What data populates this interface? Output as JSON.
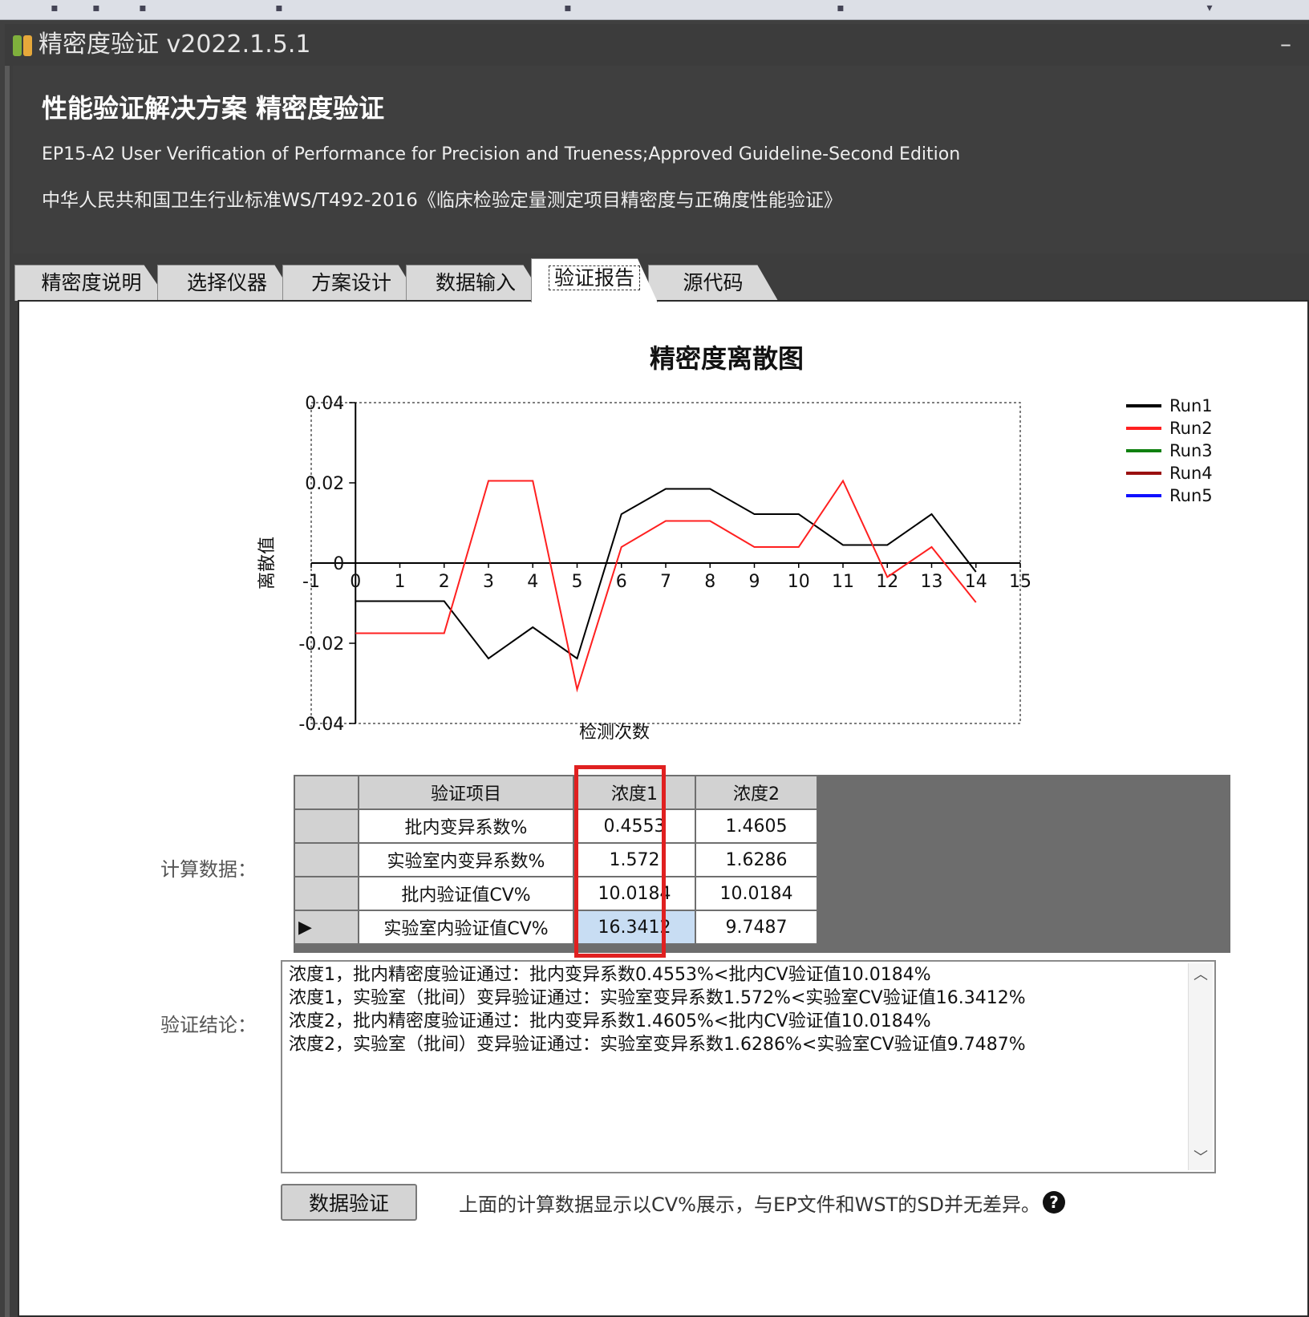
{
  "window": {
    "title": "精密度验证 v2022.1.5.1",
    "minimize_glyph": "–"
  },
  "header": {
    "title": "性能验证解决方案 精密度验证",
    "line1": "EP15-A2 User Verification of Performance for Precision and Trueness;Approved Guideline-Second Edition",
    "line2": "中华人民共和国卫生行业标准WS/T492-2016《临床检验定量测定项目精密度与正确度性能验证》"
  },
  "tabs": [
    {
      "label": "精密度说明"
    },
    {
      "label": "选择仪器"
    },
    {
      "label": "方案设计"
    },
    {
      "label": "数据输入"
    },
    {
      "label": "验证报告",
      "active": true
    },
    {
      "label": "源代码"
    }
  ],
  "chart_data": {
    "type": "line",
    "title": "精密度离散图",
    "xlabel": "检测次数",
    "ylabel": "离散值",
    "xlim": [
      -1,
      15
    ],
    "ylim": [
      -0.04,
      0.04
    ],
    "x_ticks": [
      "-1",
      "0",
      "1",
      "2",
      "3",
      "4",
      "5",
      "6",
      "7",
      "8",
      "9",
      "10",
      "11",
      "12",
      "13",
      "14",
      "15"
    ],
    "y_ticks": [
      "0.04",
      "0.02",
      "0",
      "-0.02",
      "-0.04"
    ],
    "legend_position": "right",
    "series": [
      {
        "name": "Run1",
        "color": "#000000",
        "x": [
          0,
          1,
          2,
          3,
          4,
          5,
          6,
          7,
          8,
          9,
          10,
          11,
          12,
          13,
          14
        ],
        "y": [
          -0.0095,
          -0.0095,
          -0.0095,
          -0.0238,
          -0.016,
          -0.0238,
          0.0122,
          0.0185,
          0.0185,
          0.0122,
          0.0122,
          0.0045,
          0.0045,
          0.0122,
          -0.0022
        ]
      },
      {
        "name": "Run2",
        "color": "#ff2020",
        "x": [
          0,
          1,
          2,
          3,
          4,
          5,
          6,
          7,
          8,
          9,
          10,
          11,
          12,
          13,
          14
        ],
        "y": [
          -0.0175,
          -0.0175,
          -0.0175,
          0.0205,
          0.0205,
          -0.0315,
          0.004,
          0.0105,
          0.0105,
          0.004,
          0.004,
          0.0205,
          -0.0035,
          0.004,
          -0.0098
        ]
      },
      {
        "name": "Run3",
        "color": "#108010",
        "x": [],
        "y": []
      },
      {
        "name": "Run4",
        "color": "#9a1010",
        "x": [],
        "y": []
      },
      {
        "name": "Run5",
        "color": "#1010ff",
        "x": [],
        "y": []
      }
    ]
  },
  "calc": {
    "label": "计算数据：",
    "columns": [
      "验证项目",
      "浓度1",
      "浓度2"
    ],
    "rows": [
      [
        "批内变异系数%",
        "0.4553",
        "1.4605"
      ],
      [
        "实验室内变异系数%",
        "1.572",
        "1.6286"
      ],
      [
        "批内验证值CV%",
        "10.0184",
        "10.0184"
      ],
      [
        "实验室内验证值CV%",
        "16.3412",
        "9.7487"
      ]
    ],
    "current_row_marker": "▶"
  },
  "conclusion": {
    "label": "验证结论：",
    "text": "浓度1，批内精密度验证通过：批内变异系数0.4553%<批内CV验证值10.0184%\n浓度1，实验室（批间）变异验证通过：实验室变异系数1.572%<实验室CV验证值16.3412%\n浓度2，批内精密度验证通过：批内变异系数1.4605%<批内CV验证值10.0184%\n浓度2，实验室（批间）变异验证通过：实验室变异系数1.6286%<实验室CV验证值9.7487%"
  },
  "footer": {
    "button_label": "数据验证",
    "note": "上面的计算数据显示以CV%展示，与EP文件和WST的SD并无差异。",
    "help_glyph": "?"
  },
  "colors": {
    "highlight_box": "#e02020",
    "selected_cell": "#c8ddf3"
  }
}
